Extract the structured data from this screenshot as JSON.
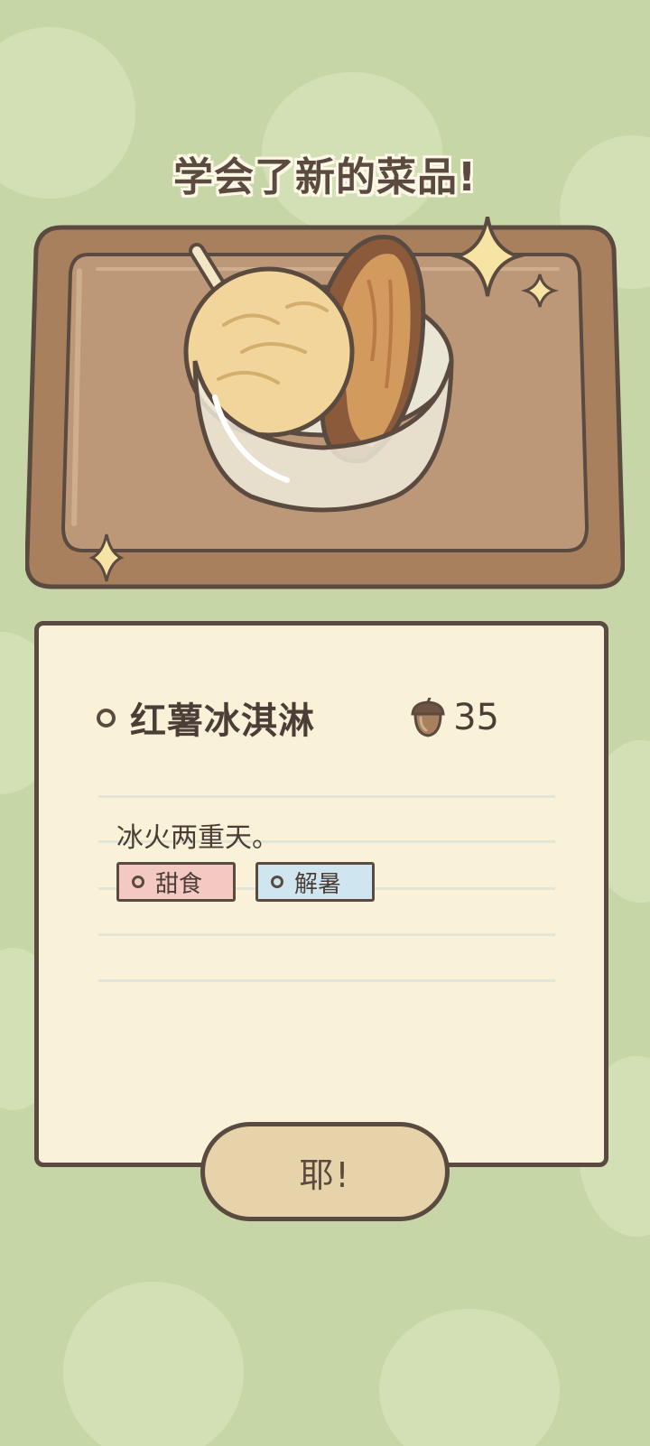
{
  "header": {
    "title": "学会了新的菜品!"
  },
  "dish": {
    "name": "红薯冰淇淋",
    "price": "35",
    "price_icon": "acorn-icon",
    "description": "冰火两重天。",
    "tags": [
      {
        "label": "甜食",
        "color": "#f3c9c1"
      },
      {
        "label": "解暑",
        "color": "#cfe5ef"
      }
    ]
  },
  "actions": {
    "confirm_label": "耶!"
  },
  "colors": {
    "background": "#c7d6a6",
    "card": "#faf2d8",
    "outline": "#5a4a40",
    "tray": "#a8805e",
    "button": "#e7d3aa"
  }
}
